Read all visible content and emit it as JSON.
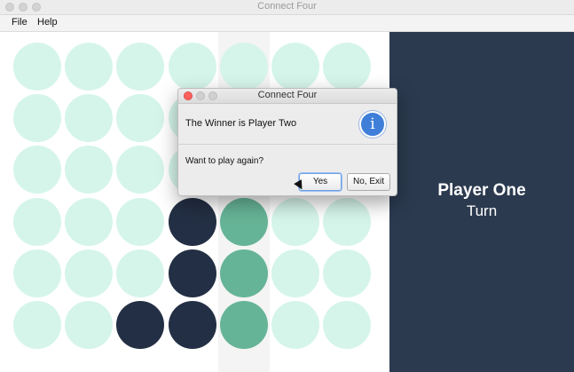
{
  "window": {
    "title": "Connect Four",
    "menu": [
      "File",
      "Help"
    ]
  },
  "board": {
    "rows": 6,
    "columns": 7,
    "cells": [
      [
        "empty",
        "empty",
        "empty",
        "empty",
        "empty",
        "empty",
        "empty"
      ],
      [
        "empty",
        "empty",
        "empty",
        "empty",
        "empty",
        "empty",
        "empty"
      ],
      [
        "empty",
        "empty",
        "empty",
        "empty",
        "empty",
        "empty",
        "empty"
      ],
      [
        "empty",
        "empty",
        "empty",
        "p1",
        "p2",
        "empty",
        "empty"
      ],
      [
        "empty",
        "empty",
        "empty",
        "p1",
        "p2",
        "empty",
        "empty"
      ],
      [
        "empty",
        "empty",
        "p1",
        "p1",
        "p2",
        "empty",
        "empty"
      ]
    ],
    "colors": {
      "empty": "#d5f5ea",
      "p1": "#232f44",
      "p2": "#66b497",
      "panel": "#2b3a4f"
    }
  },
  "status": {
    "player": "Player One",
    "turn": "Turn"
  },
  "dialog": {
    "title": "Connect Four",
    "message": "The Winner is Player Two",
    "icon": "info-icon",
    "question": "Want to play again?",
    "yes_label": "Yes",
    "exit_label": "No, Exit"
  }
}
